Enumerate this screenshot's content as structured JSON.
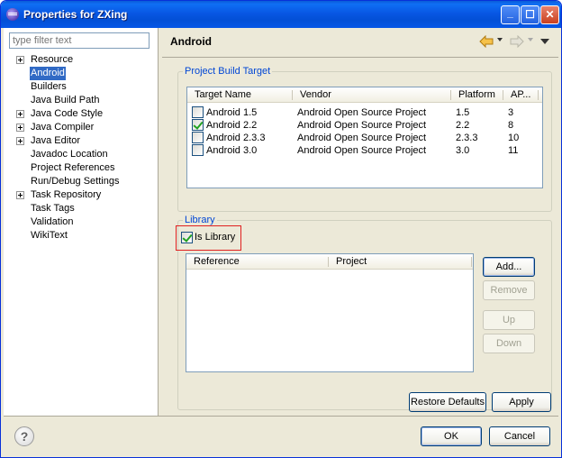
{
  "window": {
    "title": "Properties for ZXing"
  },
  "filter": {
    "placeholder": "type filter text"
  },
  "tree": {
    "items": [
      {
        "label": "Resource",
        "expandable": true,
        "selected": false
      },
      {
        "label": "Android",
        "expandable": false,
        "selected": true
      },
      {
        "label": "Builders",
        "expandable": false,
        "selected": false
      },
      {
        "label": "Java Build Path",
        "expandable": false,
        "selected": false
      },
      {
        "label": "Java Code Style",
        "expandable": true,
        "selected": false
      },
      {
        "label": "Java Compiler",
        "expandable": true,
        "selected": false
      },
      {
        "label": "Java Editor",
        "expandable": true,
        "selected": false
      },
      {
        "label": "Javadoc Location",
        "expandable": false,
        "selected": false
      },
      {
        "label": "Project References",
        "expandable": false,
        "selected": false
      },
      {
        "label": "Run/Debug Settings",
        "expandable": false,
        "selected": false
      },
      {
        "label": "Task Repository",
        "expandable": true,
        "selected": false
      },
      {
        "label": "Task Tags",
        "expandable": false,
        "selected": false
      },
      {
        "label": "Validation",
        "expandable": false,
        "selected": false
      },
      {
        "label": "WikiText",
        "expandable": false,
        "selected": false
      }
    ]
  },
  "header": {
    "title": "Android"
  },
  "build_target": {
    "legend": "Project Build Target",
    "columns": [
      "Target Name",
      "Vendor",
      "Platform",
      "AP..."
    ],
    "rows": [
      {
        "name": "Android 1.5",
        "vendor": "Android Open Source Project",
        "platform": "1.5",
        "api": "3",
        "checked": false
      },
      {
        "name": "Android 2.2",
        "vendor": "Android Open Source Project",
        "platform": "2.2",
        "api": "8",
        "checked": true
      },
      {
        "name": "Android 2.3.3",
        "vendor": "Android Open Source Project",
        "platform": "2.3.3",
        "api": "10",
        "checked": false
      },
      {
        "name": "Android 3.0",
        "vendor": "Android Open Source Project",
        "platform": "3.0",
        "api": "11",
        "checked": false
      }
    ]
  },
  "library": {
    "legend": "Library",
    "is_library_label": "Is Library",
    "is_library_checked": true,
    "columns": [
      "Reference",
      "Project"
    ],
    "buttons": {
      "add": "Add...",
      "remove": "Remove",
      "up": "Up",
      "down": "Down"
    }
  },
  "footer": {
    "restore_defaults": "Restore Defaults",
    "apply": "Apply",
    "ok": "OK",
    "cancel": "Cancel",
    "help_glyph": "?"
  },
  "colors": {
    "selection": "#316ac5",
    "title_bar": "#0857e4",
    "highlight_box": "#e02020"
  }
}
